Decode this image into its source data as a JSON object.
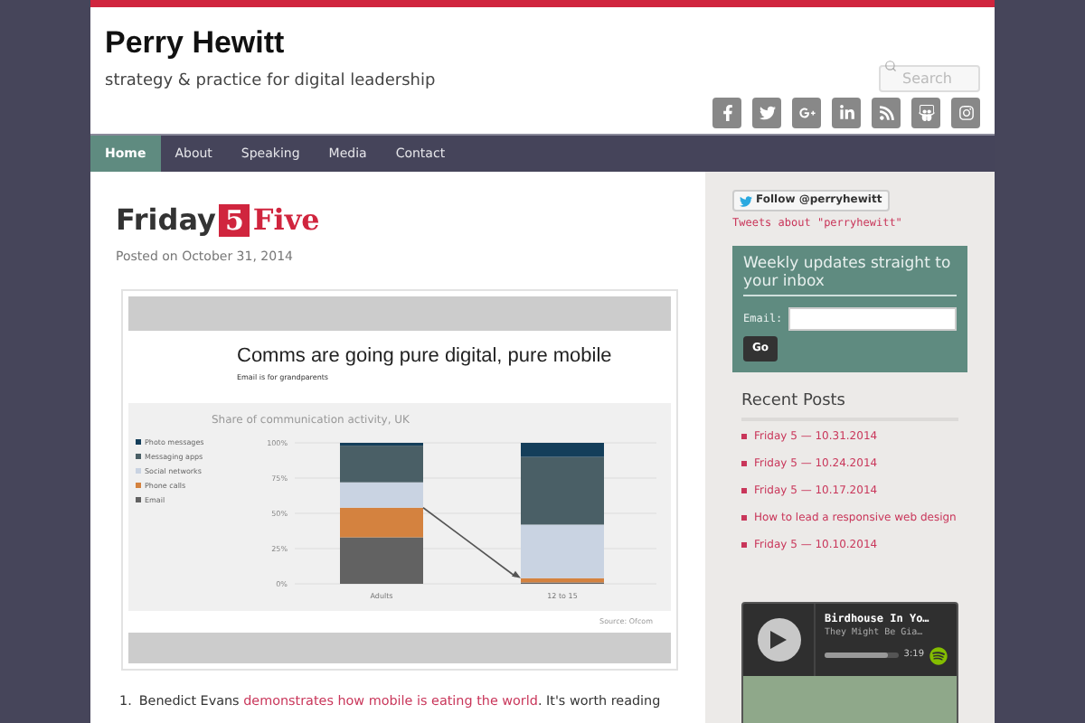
{
  "site": {
    "title": "Perry Hewitt",
    "tagline": "strategy & practice for digital leadership",
    "search": {
      "placeholder": "Search"
    }
  },
  "nav": [
    {
      "label": "Home",
      "selected": true
    },
    {
      "label": "About",
      "selected": false
    },
    {
      "label": "Speaking",
      "selected": false
    },
    {
      "label": "Media",
      "selected": false
    },
    {
      "label": "Contact",
      "selected": false
    }
  ],
  "post": {
    "logo": {
      "word": "Friday",
      "number": "5",
      "word_2": "Five"
    },
    "meta": "Posted on October 31, 2014",
    "slide": {
      "title": "Comms are going pure digital, pure mobile",
      "subtitle": "Email is for grandparents",
      "source": "Source: Ofcom",
      "chart_data": {
        "type": "bar",
        "stacked": true,
        "title": "Share of communication activity, UK",
        "categories": [
          "Adults",
          "12 to 15"
        ],
        "yticks": [
          {
            "value": 0,
            "label": "0%"
          },
          {
            "value": 25,
            "label": "25%"
          },
          {
            "value": 50,
            "label": "50%"
          },
          {
            "value": 75,
            "label": "75%"
          },
          {
            "value": 100,
            "label": "100%"
          }
        ],
        "ylim": [
          0,
          100
        ],
        "series": [
          {
            "name": "Email",
            "color": "#626262",
            "values": [
              33,
              1
            ]
          },
          {
            "name": "Phone calls",
            "color": "#d4823f",
            "values": [
              21,
              3
            ]
          },
          {
            "name": "Social networks",
            "color": "#c9d3e2",
            "values": [
              18,
              38
            ]
          },
          {
            "name": "Messaging apps",
            "color": "#4a5f66",
            "values": [
              26,
              48
            ]
          },
          {
            "name": "Photo messages",
            "color": "#143e5a",
            "values": [
              2,
              10
            ]
          }
        ],
        "grid": true,
        "legend": "left"
      }
    },
    "list": [
      {
        "number": "1.",
        "before": "Benedict Evans ",
        "link": "demonstrates how mobile is eating the world",
        "after": ". It's worth reading"
      }
    ]
  },
  "sidebar": {
    "follow_button": "Follow @perryhewitt",
    "tweets_link": "Tweets about \"perryhewitt\"",
    "newsletter": {
      "heading": "Weekly updates straight to your inbox",
      "email_label": "Email:",
      "button": "Go"
    },
    "recent_posts": {
      "heading": "Recent Posts",
      "items": [
        "Friday 5 — 10.31.2014",
        "Friday 5 — 10.24.2014",
        "Friday 5 — 10.17.2014",
        "How to lead a responsive web design",
        "Friday 5 — 10.10.2014"
      ]
    },
    "player": {
      "track": "Birdhouse In Yo…",
      "artist": "They Might Be Gia…",
      "time": "3:19",
      "level": 0.85
    }
  }
}
